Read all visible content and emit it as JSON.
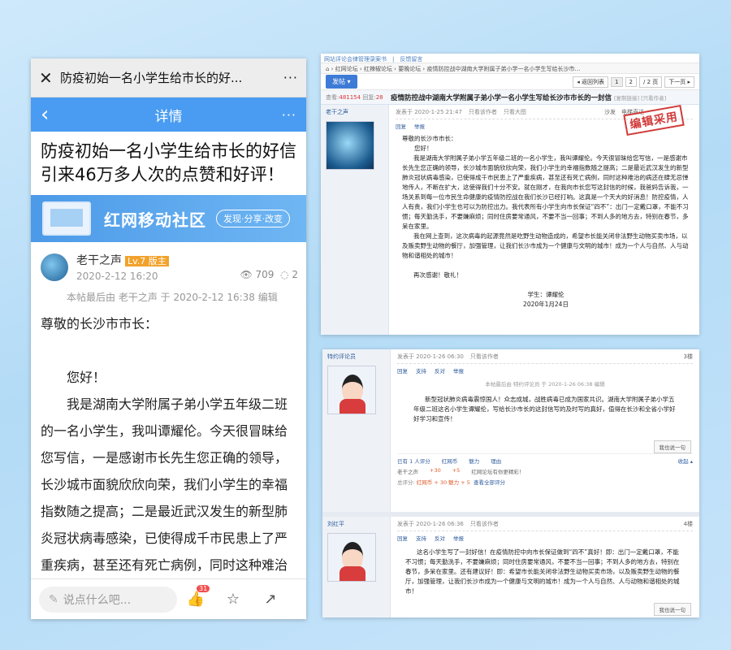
{
  "phone": {
    "wx_title": "防疫初始一名小学生给市长的好...",
    "wx_close": "✕",
    "wx_more": "···",
    "detail_title": "详情",
    "detail_back": "‹",
    "detail_more": "···",
    "post_title": "防疫初始一名小学生给市长的好信引来46万多人次的点赞和好评！",
    "banner_title": "红网移动社区",
    "banner_tag": "发现·分享·改变",
    "author_name": "老干之声",
    "author_level": "Lv.7 版主",
    "author_date": "2020-2-12 16:20",
    "views": "709",
    "comments": "2",
    "edit_note": "本帖最后由 老干之声 于 2020-2-12 16:38 编辑",
    "body": [
      "尊敬的长沙市市长：",
      "",
      "　　您好！",
      "　　我是湖南大学附属子弟小学五年级二班的一名小学生，我叫谭耀伦。今天很冒昧给您写信，一是感谢市长先生您正确的领导，长沙城市面貌欣欣向荣，我们小学生的幸福指数随之提高；二是最近武汉发生的新型肺炎冠状病毒感染，已使得成千市民患上了严重疾病，甚至还有死亡病例，同时这种难治的病还在"
    ],
    "comment_placeholder": "说点什么吧...",
    "like_badge": "31",
    "icons": {
      "pen": "✎",
      "like": "👍",
      "star": "☆",
      "share": "↗",
      "eye": "👁",
      "comment": "◌"
    }
  },
  "forum1": {
    "topline": "网站评论会律管理录案书　|　反馈留言",
    "breadcrumb": "⌂ › 红网论坛 › 红辣椒论坛 › 要晚论坛 › 疫情防控战中湖南大学附属子弟小学一名小学生写给长沙市…",
    "post_btn": "发帖 ▾",
    "pages": [
      "◂ 返回列表",
      "1",
      "2",
      "/ 2 页",
      "下一页 ▸"
    ],
    "views_label": "查看:",
    "views": "481154",
    "replies_label": "回复:",
    "replies": "28",
    "thread_title": "疫情防控战中湖南大学附属子弟小学一名小学生写给长沙市市长的一封信",
    "thread_tag": "[复制链接] [只看作者]",
    "stamp": "编辑采用",
    "user": "老干之声",
    "post_meta": "发表于 2020-1-25 21:47",
    "meta_links": [
      "只看该作者",
      "只看大图"
    ],
    "floor": "沙发　电梯直达",
    "actions": [
      "回复",
      "举报"
    ],
    "letter": [
      {
        "cls": "",
        "t": "尊敬的长沙市市长："
      },
      {
        "cls": "",
        "t": "　　您好！"
      },
      {
        "cls": "ind",
        "t": "我是湖南大学附属子弟小学五年级二班的一名小学生，我叫谭耀伦。今天很冒昧给您写信，一是感谢市长先生您正确的领导，长沙城市面貌欣欣向荣，我们小学生的幸福指数随之提高；二是最近武汉发生的新型肺炎冠状病毒感染，已使得成千市民患上了严重疾病，甚至还有死亡病例，同时这种难治的病还在肆无忌惮地传人，不断在扩大，这使得我们十分不安。就在刚才，在我向市长您写这封信的时候，我爸妈告诉我，一场关系到每一位市民生命健康的疫情防控战在我们长沙已经打响。这真是一个天大的好消息！防控疫情，人人有责，我们小学生也可以为防控出力。我代表所有小学生向市长保证“四不”：出门一定戴口罩，不能不习惯；每天勤洗手，不要嫌麻烦；同时住房要常通风，不要不当一回事；不到人多的地方去，特别在春节，多呆在家里。"
      },
      {
        "cls": "ind",
        "t": "我在网上查到，这次病毒的起源竟然是吃野生动物造成的，希望市长能关闭非法野生动物买卖市场，以及贩卖野生动物的餐厅，加强管理，让我们长沙市成为一个健康与文明的城市！成为一个人与自然、人与动物和谐相处的城市！"
      },
      {
        "cls": "",
        "t": ""
      },
      {
        "cls": "ind",
        "t": "再次感谢！敬礼！"
      },
      {
        "cls": "",
        "t": ""
      },
      {
        "cls": "c",
        "t": "学生：谭耀伦"
      },
      {
        "cls": "c",
        "t": "2020年1月24日"
      }
    ]
  },
  "forum2": {
    "post1": {
      "user": "特约评论员",
      "meta": "发表于 2020-1-26 06:30",
      "meta_link": "只看该作者",
      "floor": "3楼",
      "actions": [
        "回复",
        "支持",
        "反对",
        "举报"
      ],
      "edit_note": "本帖最后由 特约评论员 于 2020-1-26 06:38 编辑",
      "text": "新型冠状肺炎病毒震惊国人！众志成城，战胜病毒已成为国家共识。湖南大学附属子弟小学五年级二班这名小学生谭耀伦，写给长沙市长的这封信写的及时写的真好，值得在长沙和全省小学好好学习和宣传！",
      "share_btn": "我也说一句",
      "rate_header": [
        "已有 1 人评分",
        "红网币",
        "魅力",
        "理由",
        "收起 ▴"
      ],
      "rate_row": [
        "老干之声",
        "+30",
        "+5",
        "红网论坛有你更精彩！"
      ],
      "rate_total_label": "总评分: ",
      "rate_total": "红网币 + 30  魅力 + 5",
      "rate_link": "查看全部评分"
    },
    "post2": {
      "user": "刘红平",
      "meta": "发表于 2020-1-26 06:36",
      "meta_link": "只看该作者",
      "floor": "4楼",
      "actions": [
        "回复",
        "支持",
        "反对",
        "举报"
      ],
      "text": "这名小学生写了一封好信！在疫情防控中向市长保证做到“四不”真好！即：出门一定戴口罩，不能不习惯；每天勤洗手，不要嫌麻烦；同时住房要常通风，不要不当一回事；不到人多的地方去，特别在春节，多呆在家里。还有建议好！即：希望市长能关闭非法野生动物买卖市场，以及贩卖野生动物的餐厅，加强管理，让我们长沙市成为一个健康与文明的城市！成为一个人与自然、人与动物和谐相处的城市！",
      "share_btn": "我也说一句"
    }
  }
}
